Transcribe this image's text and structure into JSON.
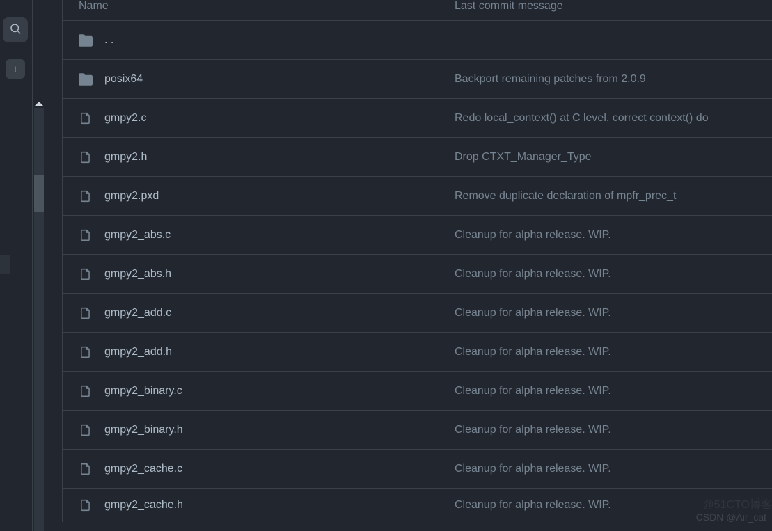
{
  "header": {
    "name_col": "Name",
    "msg_col": "Last commit message"
  },
  "sidebar": {
    "avatar_letter": "t"
  },
  "rows": [
    {
      "type": "up",
      "name": ". .",
      "msg": ""
    },
    {
      "type": "folder",
      "name": "posix64",
      "msg": "Backport remaining patches from 2.0.9"
    },
    {
      "type": "file",
      "name": "gmpy2.c",
      "msg": "Redo local_context() at C level, correct context() do"
    },
    {
      "type": "file",
      "name": "gmpy2.h",
      "msg": "Drop CTXT_Manager_Type"
    },
    {
      "type": "file",
      "name": "gmpy2.pxd",
      "msg": "Remove duplicate declaration of mpfr_prec_t"
    },
    {
      "type": "file",
      "name": "gmpy2_abs.c",
      "msg": "Cleanup for alpha release. WIP."
    },
    {
      "type": "file",
      "name": "gmpy2_abs.h",
      "msg": "Cleanup for alpha release. WIP."
    },
    {
      "type": "file",
      "name": "gmpy2_add.c",
      "msg": "Cleanup for alpha release. WIP."
    },
    {
      "type": "file",
      "name": "gmpy2_add.h",
      "msg": "Cleanup for alpha release. WIP."
    },
    {
      "type": "file",
      "name": "gmpy2_binary.c",
      "msg": "Cleanup for alpha release. WIP."
    },
    {
      "type": "file",
      "name": "gmpy2_binary.h",
      "msg": "Cleanup for alpha release. WIP."
    },
    {
      "type": "file",
      "name": "gmpy2_cache.c",
      "msg": "Cleanup for alpha release. WIP."
    },
    {
      "type": "file",
      "name": "gmpy2_cache.h",
      "msg": "Cleanup for alpha release. WIP."
    }
  ],
  "watermark": "CSDN @Air_cat",
  "watermark2": "@51CTO博客"
}
